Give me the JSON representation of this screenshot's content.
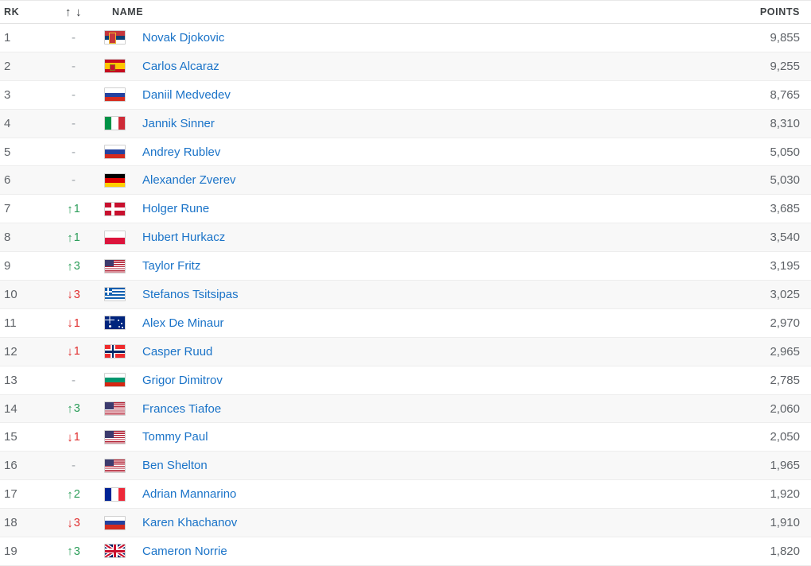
{
  "header": {
    "rank_label": "RK",
    "move_up_icon": "↑",
    "move_down_icon": "↓",
    "name_label": "NAME",
    "points_label": "POINTS"
  },
  "colors": {
    "link": "#1a73c8",
    "up": "#2e9e5b",
    "down": "#e03131",
    "text": "#5f6368",
    "row_alt": "#f8f8f8"
  },
  "rows": [
    {
      "rank": "1",
      "move_dir": "none",
      "move_value": "-",
      "flag": "SRB",
      "name": "Novak Djokovic",
      "points": "9,855"
    },
    {
      "rank": "2",
      "move_dir": "none",
      "move_value": "-",
      "flag": "ESP",
      "name": "Carlos Alcaraz",
      "points": "9,255"
    },
    {
      "rank": "3",
      "move_dir": "none",
      "move_value": "-",
      "flag": "RUS",
      "name": "Daniil Medvedev",
      "points": "8,765"
    },
    {
      "rank": "4",
      "move_dir": "none",
      "move_value": "-",
      "flag": "ITA",
      "name": "Jannik Sinner",
      "points": "8,310"
    },
    {
      "rank": "5",
      "move_dir": "none",
      "move_value": "-",
      "flag": "RUS",
      "name": "Andrey Rublev",
      "points": "5,050"
    },
    {
      "rank": "6",
      "move_dir": "none",
      "move_value": "-",
      "flag": "GER",
      "name": "Alexander Zverev",
      "points": "5,030"
    },
    {
      "rank": "7",
      "move_dir": "up",
      "move_value": "1",
      "flag": "DEN",
      "name": "Holger Rune",
      "points": "3,685"
    },
    {
      "rank": "8",
      "move_dir": "up",
      "move_value": "1",
      "flag": "POL",
      "name": "Hubert Hurkacz",
      "points": "3,540"
    },
    {
      "rank": "9",
      "move_dir": "up",
      "move_value": "3",
      "flag": "USA",
      "name": "Taylor Fritz",
      "points": "3,195"
    },
    {
      "rank": "10",
      "move_dir": "down",
      "move_value": "3",
      "flag": "GRE",
      "name": "Stefanos Tsitsipas",
      "points": "3,025"
    },
    {
      "rank": "11",
      "move_dir": "down",
      "move_value": "1",
      "flag": "AUS",
      "name": "Alex De Minaur",
      "points": "2,970"
    },
    {
      "rank": "12",
      "move_dir": "down",
      "move_value": "1",
      "flag": "NOR",
      "name": "Casper Ruud",
      "points": "2,965"
    },
    {
      "rank": "13",
      "move_dir": "none",
      "move_value": "-",
      "flag": "BUL",
      "name": "Grigor Dimitrov",
      "points": "2,785"
    },
    {
      "rank": "14",
      "move_dir": "up",
      "move_value": "3",
      "flag": "USA",
      "name": "Frances Tiafoe",
      "points": "2,060"
    },
    {
      "rank": "15",
      "move_dir": "down",
      "move_value": "1",
      "flag": "USA",
      "name": "Tommy Paul",
      "points": "2,050"
    },
    {
      "rank": "16",
      "move_dir": "none",
      "move_value": "-",
      "flag": "USA",
      "name": "Ben Shelton",
      "points": "1,965"
    },
    {
      "rank": "17",
      "move_dir": "up",
      "move_value": "2",
      "flag": "FRA",
      "name": "Adrian Mannarino",
      "points": "1,920"
    },
    {
      "rank": "18",
      "move_dir": "down",
      "move_value": "3",
      "flag": "RUS",
      "name": "Karen Khachanov",
      "points": "1,910"
    },
    {
      "rank": "19",
      "move_dir": "up",
      "move_value": "3",
      "flag": "GBR",
      "name": "Cameron Norrie",
      "points": "1,820"
    }
  ]
}
